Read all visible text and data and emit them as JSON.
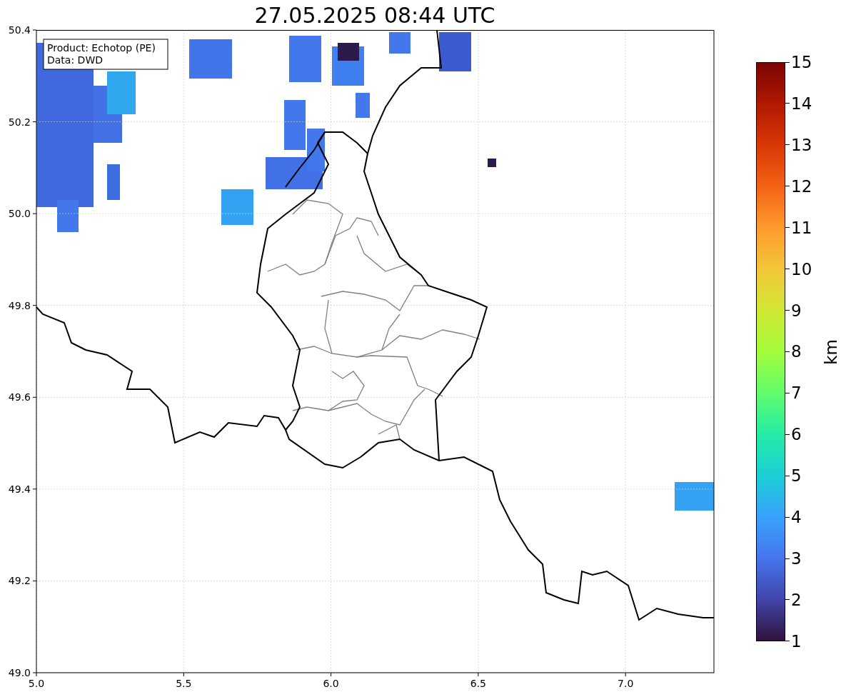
{
  "title": "27.05.2025 08:44 UTC",
  "map": {
    "annotation": [
      "Product: Echotop (PE)",
      "Data: DWD"
    ],
    "x_ticks": [
      "5.0",
      "5.5",
      "6.0",
      "6.5",
      "7.0"
    ],
    "y_ticks": [
      "50.4",
      "50.2",
      "50.0",
      "49.8",
      "49.6",
      "49.4",
      "49.2",
      "49.0"
    ]
  },
  "colorbar": {
    "label": "km",
    "ticks": [
      "15",
      "14",
      "13",
      "12",
      "11",
      "10",
      "9",
      "8",
      "7",
      "6",
      "5",
      "4",
      "3",
      "2",
      "1"
    ]
  }
}
